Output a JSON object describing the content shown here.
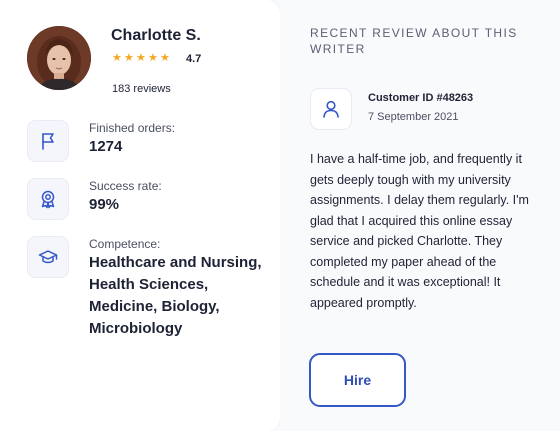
{
  "writer": {
    "name": "Charlotte S.",
    "rating": "4.7",
    "stars_filled": 5,
    "reviews": "183 reviews"
  },
  "stats": {
    "orders_label": "Finished orders:",
    "orders_value": "1274",
    "success_label": "Success rate:",
    "success_value": "99%",
    "competence_label": "Competence:",
    "competence_value": "Healthcare and Nursing, Health Sciences, Medicine, Biology, Microbiology"
  },
  "review_section": {
    "title": "RECENT REVIEW ABOUT THIS WRITER",
    "customer_id": "Customer ID #48263",
    "date": "7 September 2021",
    "text": "I have a half-time job, and frequently it gets deeply tough with my university assignments. I delay them regularly. I'm glad that I acquired this online essay service and picked Charlotte. They completed my paper ahead of the schedule and it was exceptional! It appeared promptly."
  },
  "actions": {
    "hire_label": "Hire"
  },
  "colors": {
    "accent": "#3558c8",
    "star": "#f5a623",
    "icon_stroke": "#3558c8"
  },
  "icons": {
    "orders": "flag-icon",
    "success": "award-ribbon-icon",
    "competence": "graduation-cap-icon",
    "customer": "user-icon"
  }
}
